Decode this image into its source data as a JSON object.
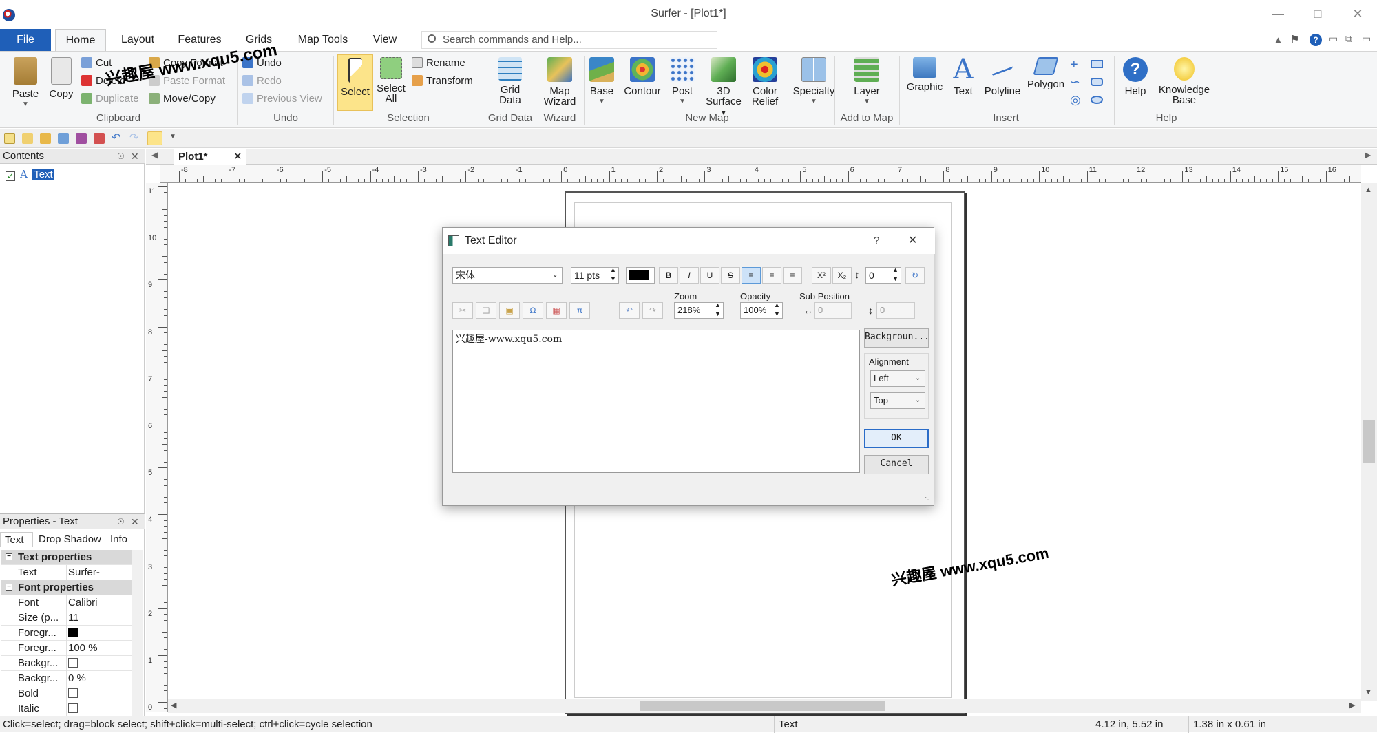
{
  "window": {
    "title": "Surfer - [Plot1*]"
  },
  "ribbon_tabs": [
    "File",
    "Home",
    "Layout",
    "Features",
    "Grids",
    "Map Tools",
    "View"
  ],
  "search": {
    "placeholder": "Search commands and Help..."
  },
  "clipboard": {
    "paste": "Paste",
    "copy": "Copy",
    "cut": "Cut",
    "delete": "Delete",
    "duplicate": "Duplicate",
    "copy_format": "Copy Format",
    "paste_format": "Paste Format",
    "move_copy": "Move/Copy",
    "label": "Clipboard"
  },
  "undo": {
    "undo": "Undo",
    "redo": "Redo",
    "previous_view": "Previous View",
    "label": "Undo"
  },
  "selection": {
    "select": "Select",
    "select_all_1": "Select",
    "select_all_2": "All",
    "rename": "Rename",
    "transform": "Transform",
    "label": "Selection"
  },
  "grid_data": {
    "b1": "Grid",
    "b2": "Data",
    "label": "Grid Data"
  },
  "wizard": {
    "b1": "Map",
    "b2": "Wizard",
    "label": "Wizard"
  },
  "new_map": {
    "base": "Base",
    "contour": "Contour",
    "post": "Post",
    "surface_1": "3D",
    "surface_2": "Surface",
    "relief_1": "Color",
    "relief_2": "Relief",
    "specialty": "Specialty",
    "label": "New Map"
  },
  "add_to_map": {
    "layer": "Layer",
    "label": "Add to Map"
  },
  "insert": {
    "graphic": "Graphic",
    "text": "Text",
    "polyline": "Polyline",
    "polygon": "Polygon",
    "label": "Insert"
  },
  "help": {
    "help": "Help",
    "kb_1": "Knowledge",
    "kb_2": "Base",
    "label": "Help"
  },
  "contents": {
    "title": "Contents",
    "item": "Text"
  },
  "properties": {
    "title": "Properties - Text",
    "tabs": [
      "Text",
      "Drop Shadow",
      "Info"
    ],
    "rows": [
      {
        "k": "Text properties",
        "v": "",
        "cat": true
      },
      {
        "k": "Text",
        "v": "Surfer-"
      },
      {
        "k": "Font properties",
        "v": "",
        "cat": true
      },
      {
        "k": "Font",
        "v": "Calibri"
      },
      {
        "k": "Size (p...",
        "v": "11"
      },
      {
        "k": "Foregr...",
        "v": ""
      },
      {
        "k": "Foregr...",
        "v": "100 %"
      },
      {
        "k": "Backgr...",
        "v": ""
      },
      {
        "k": "Backgr...",
        "v": "0 %"
      },
      {
        "k": "Bold",
        "v": ""
      },
      {
        "k": "Italic",
        "v": ""
      }
    ]
  },
  "doc_tab": "Plot1*",
  "ruler_h": [
    "-8",
    "-7",
    "-6",
    "-5",
    "-4",
    "-3",
    "-2",
    "-1",
    "0",
    "1",
    "2",
    "3",
    "4",
    "5",
    "6",
    "7",
    "8",
    "9",
    "10",
    "11",
    "12",
    "13",
    "14",
    "15",
    "16"
  ],
  "ruler_v": [
    "11",
    "10",
    "9",
    "8",
    "7",
    "6",
    "5",
    "4",
    "3",
    "2",
    "1",
    "0"
  ],
  "dialog": {
    "title": "Text Editor",
    "help": "?",
    "font": "宋体",
    "size": "11 pts",
    "line_spacing": "0",
    "zoom_label": "Zoom",
    "zoom": "218%",
    "opacity_label": "Opacity",
    "opacity": "100%",
    "subpos_label": "Sub Position",
    "subpos_x": "0",
    "subpos_y": "0",
    "text": "兴趣屋-www.xqu5.com",
    "background": "Backgroun...",
    "alignment_label": "Alignment",
    "align_h": "Left",
    "align_v": "Top",
    "ok": "OK",
    "cancel": "Cancel",
    "fmt_buttons": [
      "B",
      "I",
      "U",
      "S"
    ],
    "sup": "X²",
    "sub": "X₂"
  },
  "watermarks": {
    "top": "兴趣屋 www.xqu5.com",
    "canvas": "兴趣屋 www.xqu5.com"
  },
  "status": {
    "hint": "Click=select; drag=block select; shift+click=multi-select; ctrl+click=cycle selection",
    "object": "Text",
    "position": "4.12 in, 5.52 in",
    "size": "1.38 in x 0.61 in"
  },
  "colors": {
    "accent": "#1f5fb8",
    "selected": "#fce48a"
  }
}
